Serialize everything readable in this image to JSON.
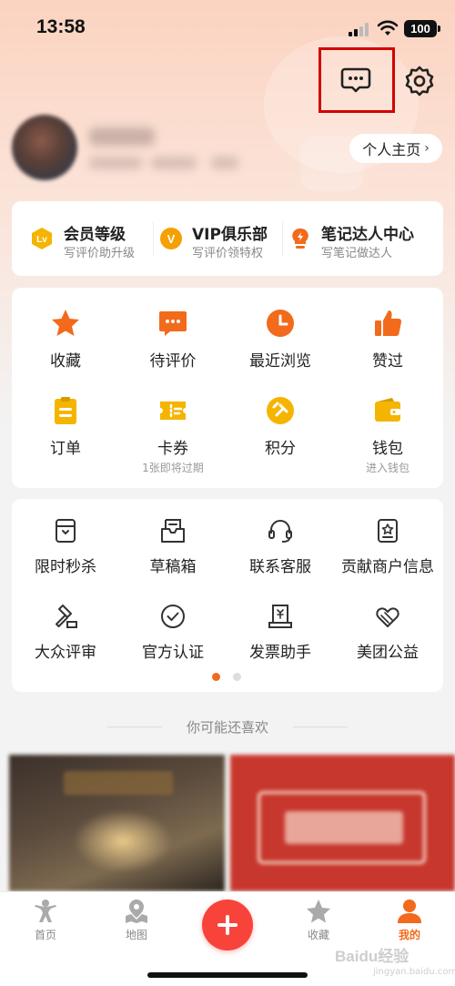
{
  "status_bar": {
    "time": "13:58",
    "battery": "100"
  },
  "profile": {
    "home_button_label": "个人主页"
  },
  "levels": [
    {
      "title": "会员等级",
      "subtitle": "写评价助升级",
      "icon": "lv-badge-icon"
    },
    {
      "title": "VIP俱乐部",
      "subtitle": "写评价领特权",
      "icon": "vip-badge-icon"
    },
    {
      "title": "笔记达人中心",
      "subtitle": "写笔记做达人",
      "icon": "bulb-badge-icon"
    }
  ],
  "main_grid": [
    {
      "label": "收藏",
      "sub": "",
      "icon": "star-icon"
    },
    {
      "label": "待评价",
      "sub": "",
      "icon": "comment-icon"
    },
    {
      "label": "最近浏览",
      "sub": "",
      "icon": "clock-icon"
    },
    {
      "label": "赞过",
      "sub": "",
      "icon": "thumbs-up-icon"
    },
    {
      "label": "订单",
      "sub": "",
      "icon": "order-icon"
    },
    {
      "label": "卡券",
      "sub": "1张即将过期",
      "icon": "coupon-icon"
    },
    {
      "label": "积分",
      "sub": "",
      "icon": "points-icon"
    },
    {
      "label": "钱包",
      "sub": "进入钱包",
      "icon": "wallet-icon"
    }
  ],
  "tools_grid": [
    {
      "label": "限时秒杀",
      "icon": "flash-sale-icon"
    },
    {
      "label": "草稿箱",
      "icon": "drafts-icon"
    },
    {
      "label": "联系客服",
      "icon": "headset-icon"
    },
    {
      "label": "贡献商户信息",
      "icon": "merchant-icon"
    },
    {
      "label": "大众评审",
      "icon": "gavel-icon"
    },
    {
      "label": "官方认证",
      "icon": "check-circle-icon"
    },
    {
      "label": "发票助手",
      "icon": "invoice-icon"
    },
    {
      "label": "美团公益",
      "icon": "charity-heart-icon"
    }
  ],
  "tools_pagination": {
    "pages": 2,
    "active": 1
  },
  "recommend": {
    "title": "你可能还喜欢"
  },
  "tab_bar": [
    {
      "label": "首页",
      "icon": "home-person-icon"
    },
    {
      "label": "地图",
      "icon": "map-pin-icon"
    },
    {
      "label": "",
      "icon": "plus-icon"
    },
    {
      "label": "收藏",
      "icon": "star-outline-icon"
    },
    {
      "label": "我的",
      "icon": "user-icon"
    }
  ],
  "watermark": {
    "main": "Baidu经验",
    "sub": "jingyan.baidu.com"
  },
  "colors": {
    "accent": "#f26a1b",
    "post_button": "#f8433b",
    "highlight_box": "#d40000"
  }
}
